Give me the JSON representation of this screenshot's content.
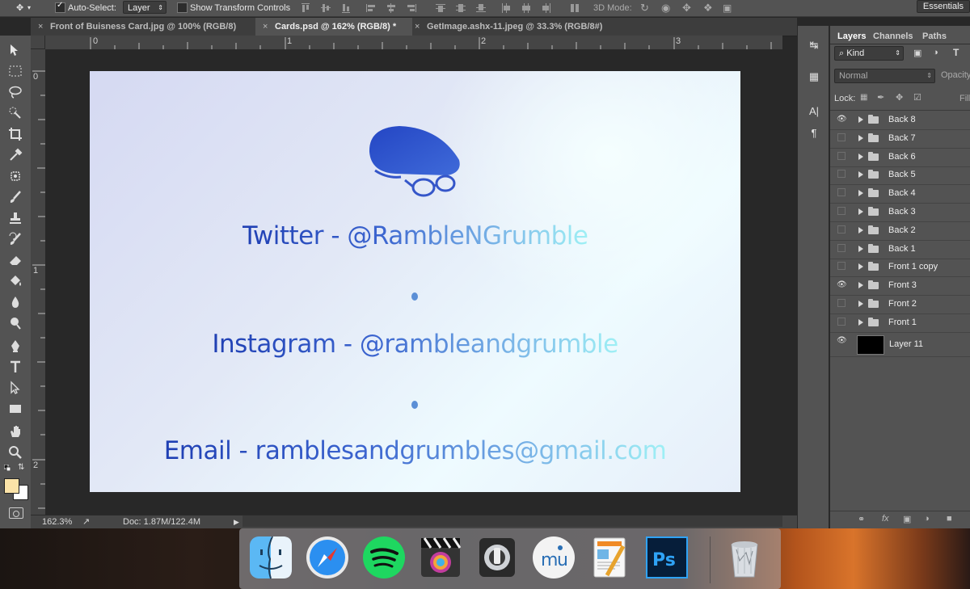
{
  "options_bar": {
    "auto_select_label": "Auto-Select:",
    "auto_select_value": "Layer",
    "transform_label": "Show Transform Controls",
    "mode_3d_label": "3D Mode:",
    "workspace": "Essentials"
  },
  "tabs": [
    {
      "label": "Front of Buisness Card.jpg @ 100% (RGB/8)",
      "active": false
    },
    {
      "label": "Cards.psd @ 162% (RGB/8) *",
      "active": true
    },
    {
      "label": "GetImage.ashx-11.jpeg @ 33.3% (RGB/8#)",
      "active": false
    }
  ],
  "ruler": {
    "top_labels": [
      "0",
      "1",
      "2",
      "3"
    ],
    "left_labels": [
      "0",
      "1",
      "2"
    ]
  },
  "card": {
    "twitter": "Twitter - @RambleNGrumble",
    "instagram": "Instagram - @rambleandgrumble",
    "email": "Email - ramblesandgrumbles@gmail.com",
    "logo_icon": "cap-and-glasses-logo",
    "colors": {
      "text_start": "#1f3fb3",
      "text_end": "#9ff0f5",
      "logo": "#2f58cf"
    }
  },
  "status": {
    "zoom": "162.3%",
    "doc": "Doc: 1.87M/122.4M"
  },
  "panel": {
    "tabs": [
      "Layers",
      "Channels",
      "Paths"
    ],
    "filter_kind": "Kind",
    "blend_mode": "Normal",
    "opacity_label": "Opacity",
    "lock_label": "Lock:",
    "fill_label": "Fill",
    "layers": [
      {
        "name": "Back 8",
        "visible": true,
        "group": true
      },
      {
        "name": "Back 7",
        "visible": false,
        "group": true
      },
      {
        "name": "Back 6",
        "visible": false,
        "group": true
      },
      {
        "name": "Back 5",
        "visible": false,
        "group": true
      },
      {
        "name": "Back 4",
        "visible": false,
        "group": true
      },
      {
        "name": "Back 3",
        "visible": false,
        "group": true
      },
      {
        "name": "Back 2",
        "visible": false,
        "group": true
      },
      {
        "name": "Back 1",
        "visible": false,
        "group": true
      },
      {
        "name": "Front 1 copy",
        "visible": false,
        "group": true
      },
      {
        "name": "Front 3",
        "visible": true,
        "group": true
      },
      {
        "name": "Front 2",
        "visible": false,
        "group": true
      },
      {
        "name": "Front 1",
        "visible": false,
        "group": true
      },
      {
        "name": "Layer 11",
        "visible": true,
        "group": false
      }
    ]
  },
  "dock": [
    "finder-icon",
    "safari-icon",
    "spotify-icon",
    "final-cut-pro-icon",
    "logic-pro-icon",
    "musescore-icon",
    "pages-icon",
    "photoshop-icon",
    "trash-icon"
  ]
}
